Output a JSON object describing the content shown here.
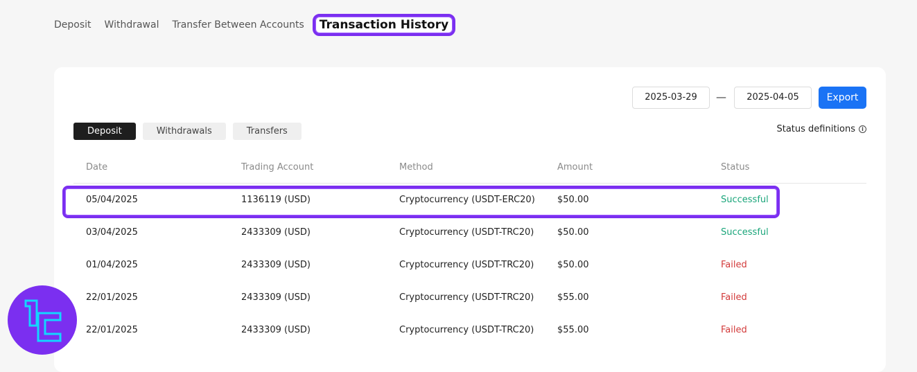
{
  "topnav": {
    "items": [
      "Deposit",
      "Withdrawal",
      "Transfer Between Accounts",
      "Transaction History"
    ]
  },
  "filters": {
    "date_from": "2025-03-29",
    "date_separator": "—",
    "date_to": "2025-04-05",
    "export_label": "Export"
  },
  "tabs": [
    "Deposit",
    "Withdrawals",
    "Transfers"
  ],
  "status_definitions": "Status definitions",
  "table": {
    "headers": [
      "Date",
      "Trading Account",
      "Method",
      "Amount",
      "Status"
    ],
    "rows": [
      {
        "date": "05/04/2025",
        "account": "1136119 (USD)",
        "method": "Cryptocurrency (USDT-ERC20)",
        "amount": "$50.00",
        "status": "Successful"
      },
      {
        "date": "03/04/2025",
        "account": "2433309 (USD)",
        "method": "Cryptocurrency (USDT-TRC20)",
        "amount": "$50.00",
        "status": "Successful"
      },
      {
        "date": "01/04/2025",
        "account": "2433309 (USD)",
        "method": "Cryptocurrency (USDT-TRC20)",
        "amount": "$50.00",
        "status": "Failed"
      },
      {
        "date": "22/01/2025",
        "account": "2433309 (USD)",
        "method": "Cryptocurrency (USDT-TRC20)",
        "amount": "$55.00",
        "status": "Failed"
      },
      {
        "date": "22/01/2025",
        "account": "2433309 (USD)",
        "method": "Cryptocurrency (USDT-TRC20)",
        "amount": "$55.00",
        "status": "Failed"
      }
    ]
  },
  "colors": {
    "accent": "#1a73f5",
    "highlight": "#7b2ff0",
    "success": "#1aa57a",
    "failed": "#d23a3a"
  }
}
